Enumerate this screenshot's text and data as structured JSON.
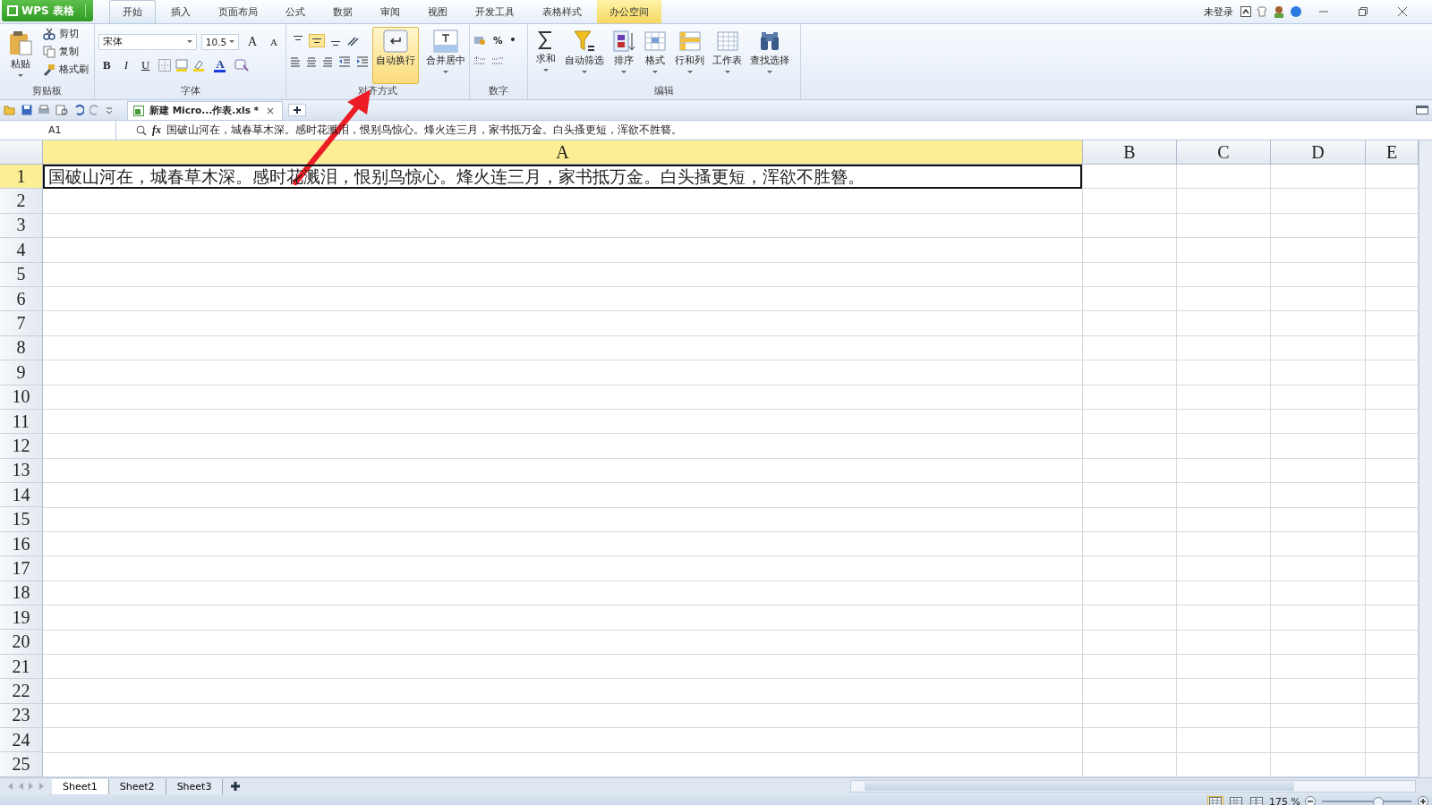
{
  "app_button": {
    "label": "WPS 表格"
  },
  "menu_tabs": [
    {
      "label": "开始",
      "selected": true,
      "kind": "normal"
    },
    {
      "label": "插入",
      "selected": false,
      "kind": "normal"
    },
    {
      "label": "页面布局",
      "selected": false,
      "kind": "normal"
    },
    {
      "label": "公式",
      "selected": false,
      "kind": "normal"
    },
    {
      "label": "数据",
      "selected": false,
      "kind": "normal"
    },
    {
      "label": "审阅",
      "selected": false,
      "kind": "normal"
    },
    {
      "label": "视图",
      "selected": false,
      "kind": "normal"
    },
    {
      "label": "开发工具",
      "selected": false,
      "kind": "normal"
    },
    {
      "label": "表格样式",
      "selected": false,
      "kind": "normal"
    },
    {
      "label": "办公空间",
      "selected": false,
      "kind": "highlight"
    }
  ],
  "account": {
    "label": "未登录"
  },
  "ribbon": {
    "clipboard": {
      "title": "剪贴板",
      "paste": "粘贴",
      "actions": [
        "剪切",
        "复制",
        "格式刷"
      ]
    },
    "font": {
      "title": "字体",
      "font_name": "宋体",
      "font_size": "10.5",
      "size_buttons": [
        "A",
        "A"
      ],
      "style_buttons": [
        "B",
        "I",
        "U"
      ],
      "font_color_button": "A"
    },
    "alignment": {
      "title": "对齐方式",
      "vertical_align": [
        {
          "selected": false
        },
        {
          "selected": true
        },
        {
          "selected": false
        }
      ],
      "big_buttons": [
        {
          "label": "自动换行",
          "selected": true
        },
        {
          "label": "合并居中",
          "selected": false
        }
      ]
    },
    "number": {
      "title": "数字",
      "percent_button": "%"
    },
    "editing": {
      "title": "编辑",
      "buttons": [
        "求和",
        "自动筛选",
        "排序",
        "格式",
        "行和列",
        "工作表",
        "查找选择"
      ]
    }
  },
  "document_tab": {
    "label": "新建 Micro...作表.xls *",
    "close": "×"
  },
  "formula_bar": {
    "name_box": "A1",
    "function_label": "fx",
    "content": "国破山河在，城春草木深。感时花溅泪，恨别鸟惊心。烽火连三月，家书抵万金。白头搔更短，浑欲不胜簪。"
  },
  "columns": [
    {
      "label": "A",
      "selected": true
    },
    {
      "label": "B",
      "selected": false
    },
    {
      "label": "C",
      "selected": false
    },
    {
      "label": "D",
      "selected": false
    },
    {
      "label": "E",
      "selected": false
    }
  ],
  "rows": [
    {
      "label": "1",
      "selected": true,
      "cells": [
        "国破山河在，城春草木深。感时花溅泪，恨别鸟惊心。烽火连三月，家书抵万金。白头搔更短，浑欲不胜簪。"
      ]
    },
    {
      "label": "2",
      "selected": false
    },
    {
      "label": "3",
      "selected": false
    },
    {
      "label": "4",
      "selected": false
    },
    {
      "label": "5",
      "selected": false
    },
    {
      "label": "6",
      "selected": false
    },
    {
      "label": "7",
      "selected": false
    },
    {
      "label": "8",
      "selected": false
    },
    {
      "label": "9",
      "selected": false
    },
    {
      "label": "10",
      "selected": false
    },
    {
      "label": "11",
      "selected": false
    },
    {
      "label": "12",
      "selected": false
    },
    {
      "label": "13",
      "selected": false
    },
    {
      "label": "14",
      "selected": false
    },
    {
      "label": "15",
      "selected": false
    },
    {
      "label": "16",
      "selected": false
    },
    {
      "label": "17",
      "selected": false
    },
    {
      "label": "18",
      "selected": false
    },
    {
      "label": "19",
      "selected": false
    },
    {
      "label": "20",
      "selected": false
    },
    {
      "label": "21",
      "selected": false
    },
    {
      "label": "22",
      "selected": false
    },
    {
      "label": "23",
      "selected": false
    },
    {
      "label": "24",
      "selected": false
    },
    {
      "label": "25",
      "selected": false
    }
  ],
  "sheet_tabs": [
    {
      "label": "Sheet1",
      "selected": true
    },
    {
      "label": "Sheet2",
      "selected": false
    },
    {
      "label": "Sheet3",
      "selected": false
    }
  ],
  "status_bar": {
    "view_modes": [
      {
        "selected": true
      },
      {
        "selected": false
      },
      {
        "selected": false
      }
    ],
    "zoom": "175 %",
    "zoom_slider": {
      "level": 0.62
    }
  }
}
